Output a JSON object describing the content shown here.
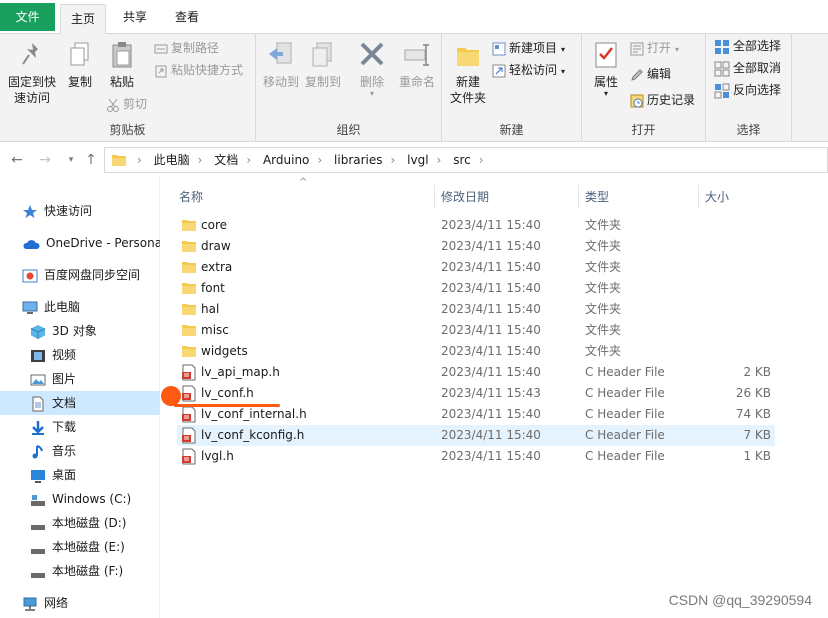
{
  "tabs": {
    "file": "文件",
    "home": "主页",
    "share": "共享",
    "view": "查看"
  },
  "ribbon": {
    "clipboard": {
      "pin": "固定到快\n速访问",
      "copy": "复制",
      "paste": "粘贴",
      "copy_path": "复制路径",
      "paste_shortcut": "粘贴快捷方式",
      "cut": "剪切",
      "label": "剪贴板"
    },
    "organize": {
      "move_to": "移动到",
      "copy_to": "复制到",
      "delete": "删除",
      "rename": "重命名",
      "label": "组织"
    },
    "new": {
      "new_folder": "新建\n文件夹",
      "new_item": "新建项目",
      "easy_access": "轻松访问",
      "label": "新建"
    },
    "open": {
      "properties": "属性",
      "open": "打开",
      "edit": "编辑",
      "history": "历史记录",
      "label": "打开"
    },
    "select": {
      "select_all": "全部选择",
      "select_none": "全部取消",
      "invert": "反向选择",
      "label": "选择"
    }
  },
  "address": {
    "crumbs": [
      "此电脑",
      "文档",
      "Arduino",
      "libraries",
      "lvgl",
      "src"
    ]
  },
  "sidebar": {
    "items": [
      {
        "label": "快速访问",
        "icon": "star-icon"
      },
      {
        "label": "OneDrive - Persona",
        "icon": "cloud-icon"
      },
      {
        "label": "百度网盘同步空间",
        "icon": "baidu-icon"
      },
      {
        "label": "此电脑",
        "icon": "computer-icon"
      },
      {
        "label": "3D 对象",
        "icon": "cube-icon"
      },
      {
        "label": "视频",
        "icon": "video-icon"
      },
      {
        "label": "图片",
        "icon": "picture-icon"
      },
      {
        "label": "文档",
        "icon": "document-icon"
      },
      {
        "label": "下载",
        "icon": "download-icon"
      },
      {
        "label": "音乐",
        "icon": "music-icon"
      },
      {
        "label": "桌面",
        "icon": "desktop-icon"
      },
      {
        "label": "Windows (C:)",
        "icon": "drive-icon"
      },
      {
        "label": "本地磁盘 (D:)",
        "icon": "drive-icon"
      },
      {
        "label": "本地磁盘 (E:)",
        "icon": "drive-icon"
      },
      {
        "label": "本地磁盘 (F:)",
        "icon": "drive-icon"
      },
      {
        "label": "网络",
        "icon": "network-icon"
      }
    ]
  },
  "columns": {
    "name": "名称",
    "date": "修改日期",
    "type": "类型",
    "size": "大小"
  },
  "files": [
    {
      "name": "core",
      "date": "2023/4/11 15:40",
      "type": "文件夹",
      "size": "",
      "kind": "folder"
    },
    {
      "name": "draw",
      "date": "2023/4/11 15:40",
      "type": "文件夹",
      "size": "",
      "kind": "folder"
    },
    {
      "name": "extra",
      "date": "2023/4/11 15:40",
      "type": "文件夹",
      "size": "",
      "kind": "folder"
    },
    {
      "name": "font",
      "date": "2023/4/11 15:40",
      "type": "文件夹",
      "size": "",
      "kind": "folder"
    },
    {
      "name": "hal",
      "date": "2023/4/11 15:40",
      "type": "文件夹",
      "size": "",
      "kind": "folder"
    },
    {
      "name": "misc",
      "date": "2023/4/11 15:40",
      "type": "文件夹",
      "size": "",
      "kind": "folder"
    },
    {
      "name": "widgets",
      "date": "2023/4/11 15:40",
      "type": "文件夹",
      "size": "",
      "kind": "folder"
    },
    {
      "name": "lv_api_map.h",
      "date": "2023/4/11 15:40",
      "type": "C Header File",
      "size": "2 KB",
      "kind": "header"
    },
    {
      "name": "lv_conf.h",
      "date": "2023/4/11 15:43",
      "type": "C Header File",
      "size": "26 KB",
      "kind": "header"
    },
    {
      "name": "lv_conf_internal.h",
      "date": "2023/4/11 15:40",
      "type": "C Header File",
      "size": "74 KB",
      "kind": "header"
    },
    {
      "name": "lv_conf_kconfig.h",
      "date": "2023/4/11 15:40",
      "type": "C Header File",
      "size": "7 KB",
      "kind": "header"
    },
    {
      "name": "lvgl.h",
      "date": "2023/4/11 15:40",
      "type": "C Header File",
      "size": "1 KB",
      "kind": "header"
    }
  ],
  "watermark": "CSDN @qq_39290594",
  "colors": {
    "file_tab": "#19a05f",
    "selection": "#cde8ff",
    "hover": "#e5f3ff",
    "annotation": "#ff5a14",
    "folder": "#f8d775"
  }
}
